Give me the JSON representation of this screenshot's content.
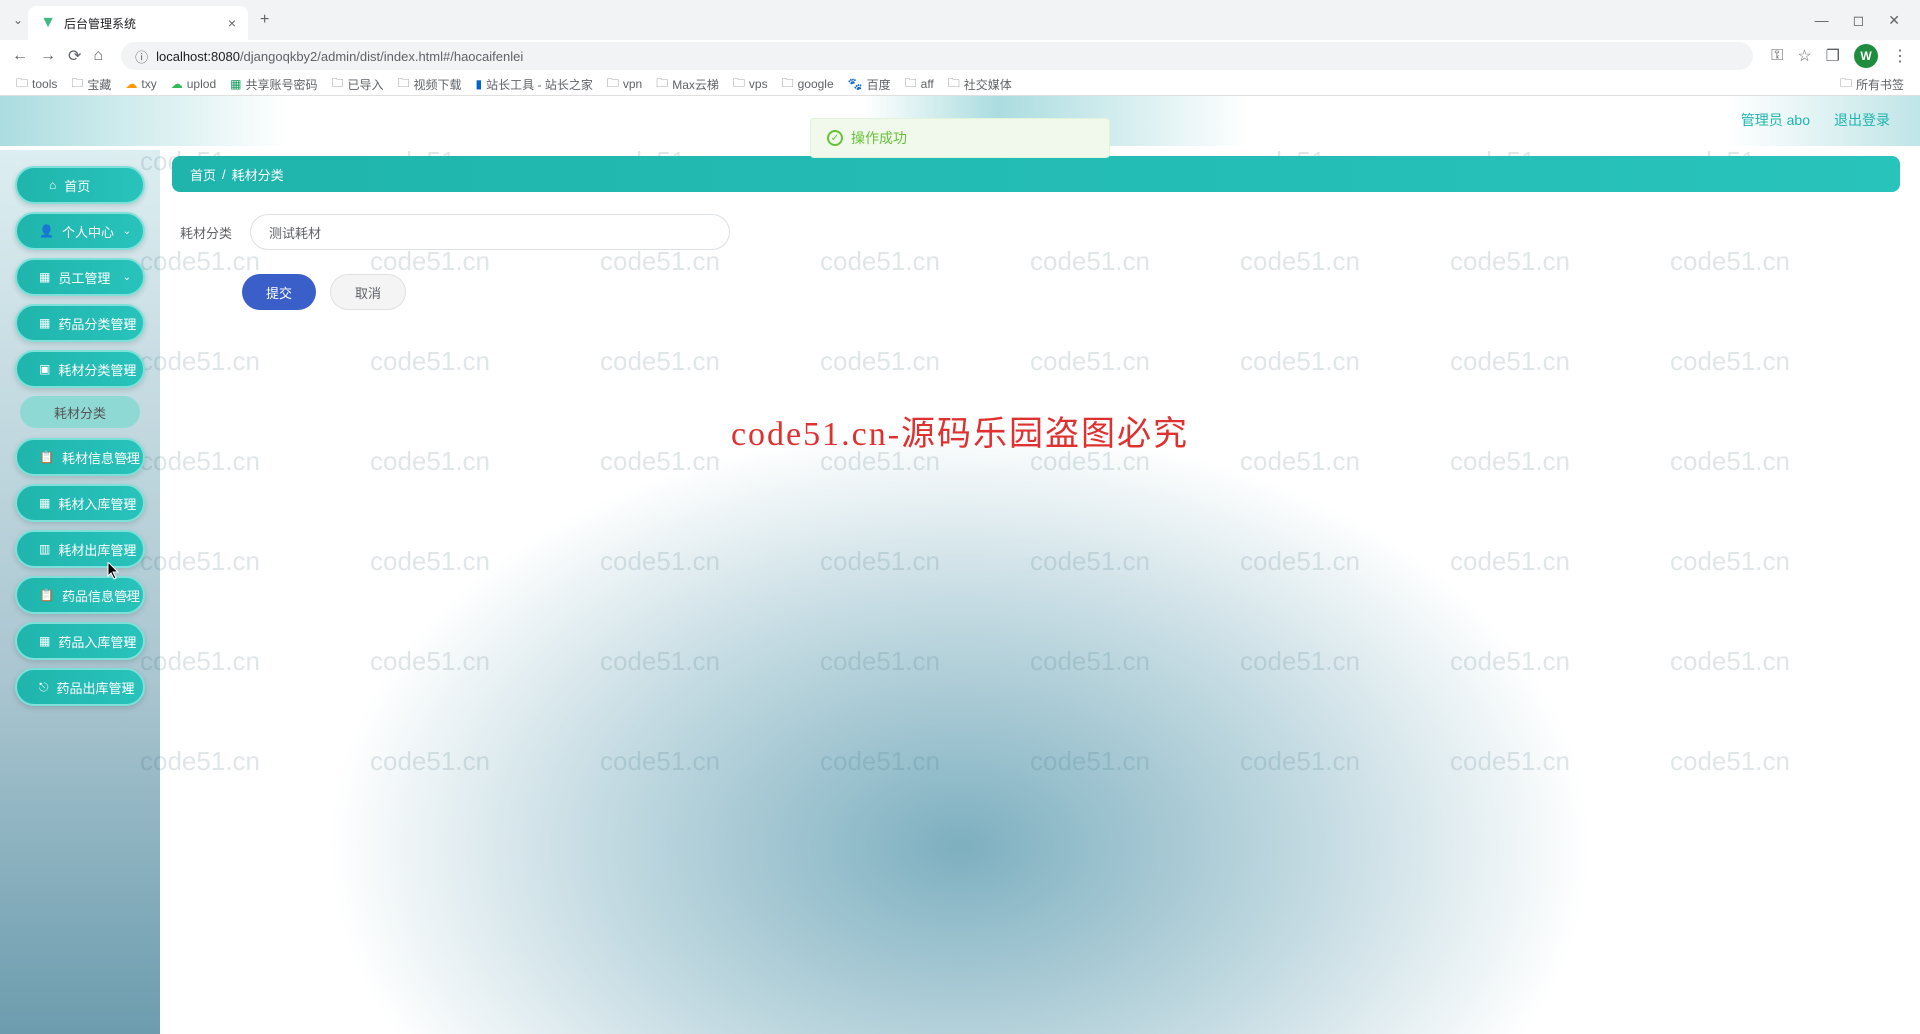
{
  "browser": {
    "tab_title": "后台管理系统",
    "url_host": "localhost:8080",
    "url_path": "/djangoqkby2/admin/dist/index.html#/haocaifenlei",
    "avatar_letter": "W",
    "bookmarks": [
      "tools",
      "宝藏",
      "txy",
      "uplod",
      "共享账号密码",
      "已导入",
      "视频下载",
      "站长工具 - 站长之家",
      "vpn",
      "Max云梯",
      "vps",
      "google",
      "百度",
      "aff",
      "社交媒体"
    ],
    "all_bookmarks": "所有书签"
  },
  "header": {
    "user": "管理员 abo",
    "logout": "退出登录"
  },
  "toast": {
    "message": "操作成功"
  },
  "sidebar": {
    "items": [
      {
        "label": "首页",
        "icon": "home-icon",
        "has_chevron": false
      },
      {
        "label": "个人中心",
        "icon": "user-icon",
        "has_chevron": true
      },
      {
        "label": "员工管理",
        "icon": "grid-icon",
        "has_chevron": true
      },
      {
        "label": "药品分类管理",
        "icon": "grid-icon",
        "has_chevron": true
      },
      {
        "label": "耗材分类管理",
        "icon": "monitor-icon",
        "has_chevron": true
      },
      {
        "label": "耗材信息管理",
        "icon": "clipboard-icon",
        "has_chevron": true
      },
      {
        "label": "耗材入库管理",
        "icon": "grid-icon",
        "has_chevron": true
      },
      {
        "label": "耗材出库管理",
        "icon": "chart-icon",
        "has_chevron": true
      },
      {
        "label": "药品信息管理",
        "icon": "clipboard-icon",
        "has_chevron": true
      },
      {
        "label": "药品入库管理",
        "icon": "grid-icon",
        "has_chevron": true
      },
      {
        "label": "药品出库管理",
        "icon": "export-icon",
        "has_chevron": true
      }
    ],
    "submenu": "耗材分类"
  },
  "breadcrumb": {
    "home": "首页",
    "sep": "/",
    "current": "耗材分类"
  },
  "form": {
    "label": "耗材分类",
    "value": "测试耗材",
    "submit": "提交",
    "cancel": "取消"
  },
  "overlay": "code51.cn-源码乐园盗图必究",
  "watermark": "code51.cn"
}
